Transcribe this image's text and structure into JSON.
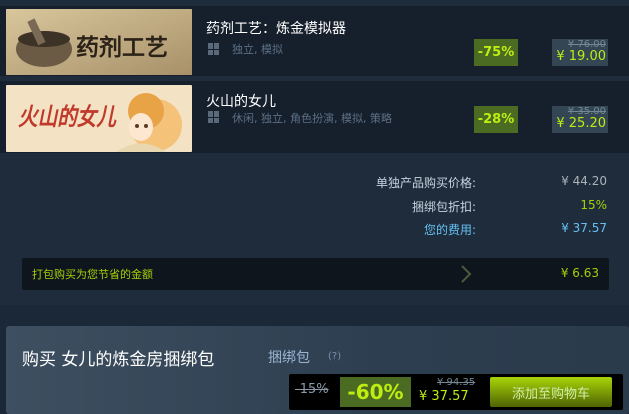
{
  "items": [
    {
      "name": "药剂工艺：炼金模拟器",
      "capsule_title": "药剂工艺",
      "tags": "独立, 模拟",
      "discount": "-75%",
      "original_price": "¥ 76.00",
      "final_price": "¥ 19.00"
    },
    {
      "name": "火山的女儿",
      "capsule_title": "火山的女儿",
      "tags": "休闲, 独立, 角色扮演, 模拟, 策略",
      "discount": "-28%",
      "original_price": "¥ 35.00",
      "final_price": "¥ 25.20"
    }
  ],
  "summary": {
    "individual_label": "单独产品购买价格:",
    "individual_value": "¥ 44.20",
    "bundle_discount_label": "捆绑包折扣:",
    "bundle_discount_value": "15%",
    "your_cost_label": "您的费用:",
    "your_cost_value": "¥ 37.57"
  },
  "savings": {
    "label": "打包购买为您节省的金额",
    "value": "¥ 6.63"
  },
  "purchase": {
    "title": "购买 女儿的炼金房捆绑包",
    "subtitle": "捆绑包",
    "help": "(?)",
    "bundle_discount": "-15%",
    "discount": "-60%",
    "original_price": "¥ 94.35",
    "final_price": "¥ 37.57",
    "add_to_cart": "添加至购物车"
  },
  "colors": {
    "discount_bg": "#4c6b22",
    "discount_text": "#beee11",
    "your_cost": "#66c0f4",
    "savings_text": "#a4d007"
  },
  "icons": [
    "windows-icon",
    "chevron-right-icon"
  ]
}
